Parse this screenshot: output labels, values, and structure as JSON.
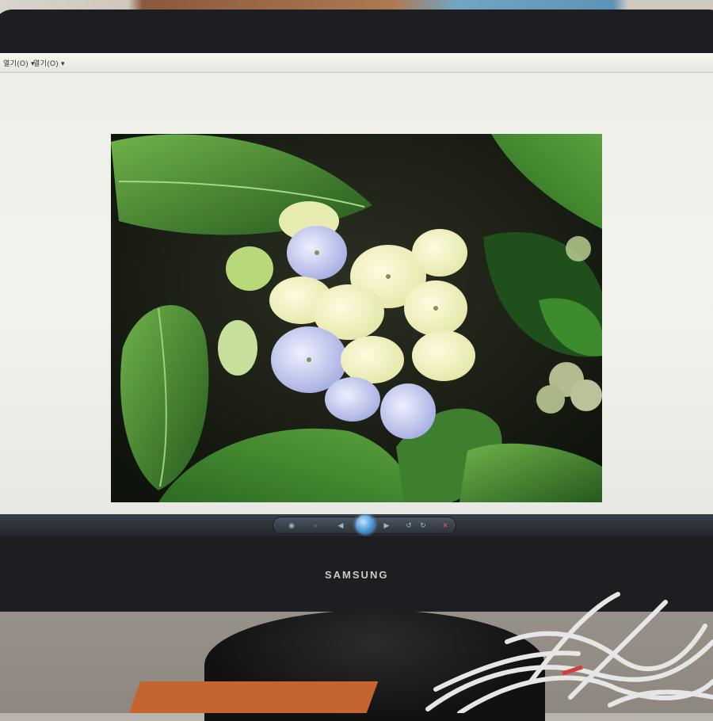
{
  "window": {
    "menu_left": "열기(O) ▾",
    "menu_right": "열기(O) ▾"
  },
  "monitor": {
    "brand": "SAMSUNG"
  },
  "photo": {
    "subject": "hydrangea-flower"
  },
  "taskbar": {
    "icons": [
      "app-red-icon",
      "internet-explorer-icon",
      "chrome-icon",
      "red-flag-app-icon",
      "picture-viewer-icon"
    ]
  },
  "colors": {
    "taskbar": "#3f89c3",
    "screen": "#f0f0ec",
    "bezel": "#1d1e21",
    "leaf": "#3e7d2e",
    "petal": "#eef0c4",
    "petal_blue": "#b4bde6"
  }
}
